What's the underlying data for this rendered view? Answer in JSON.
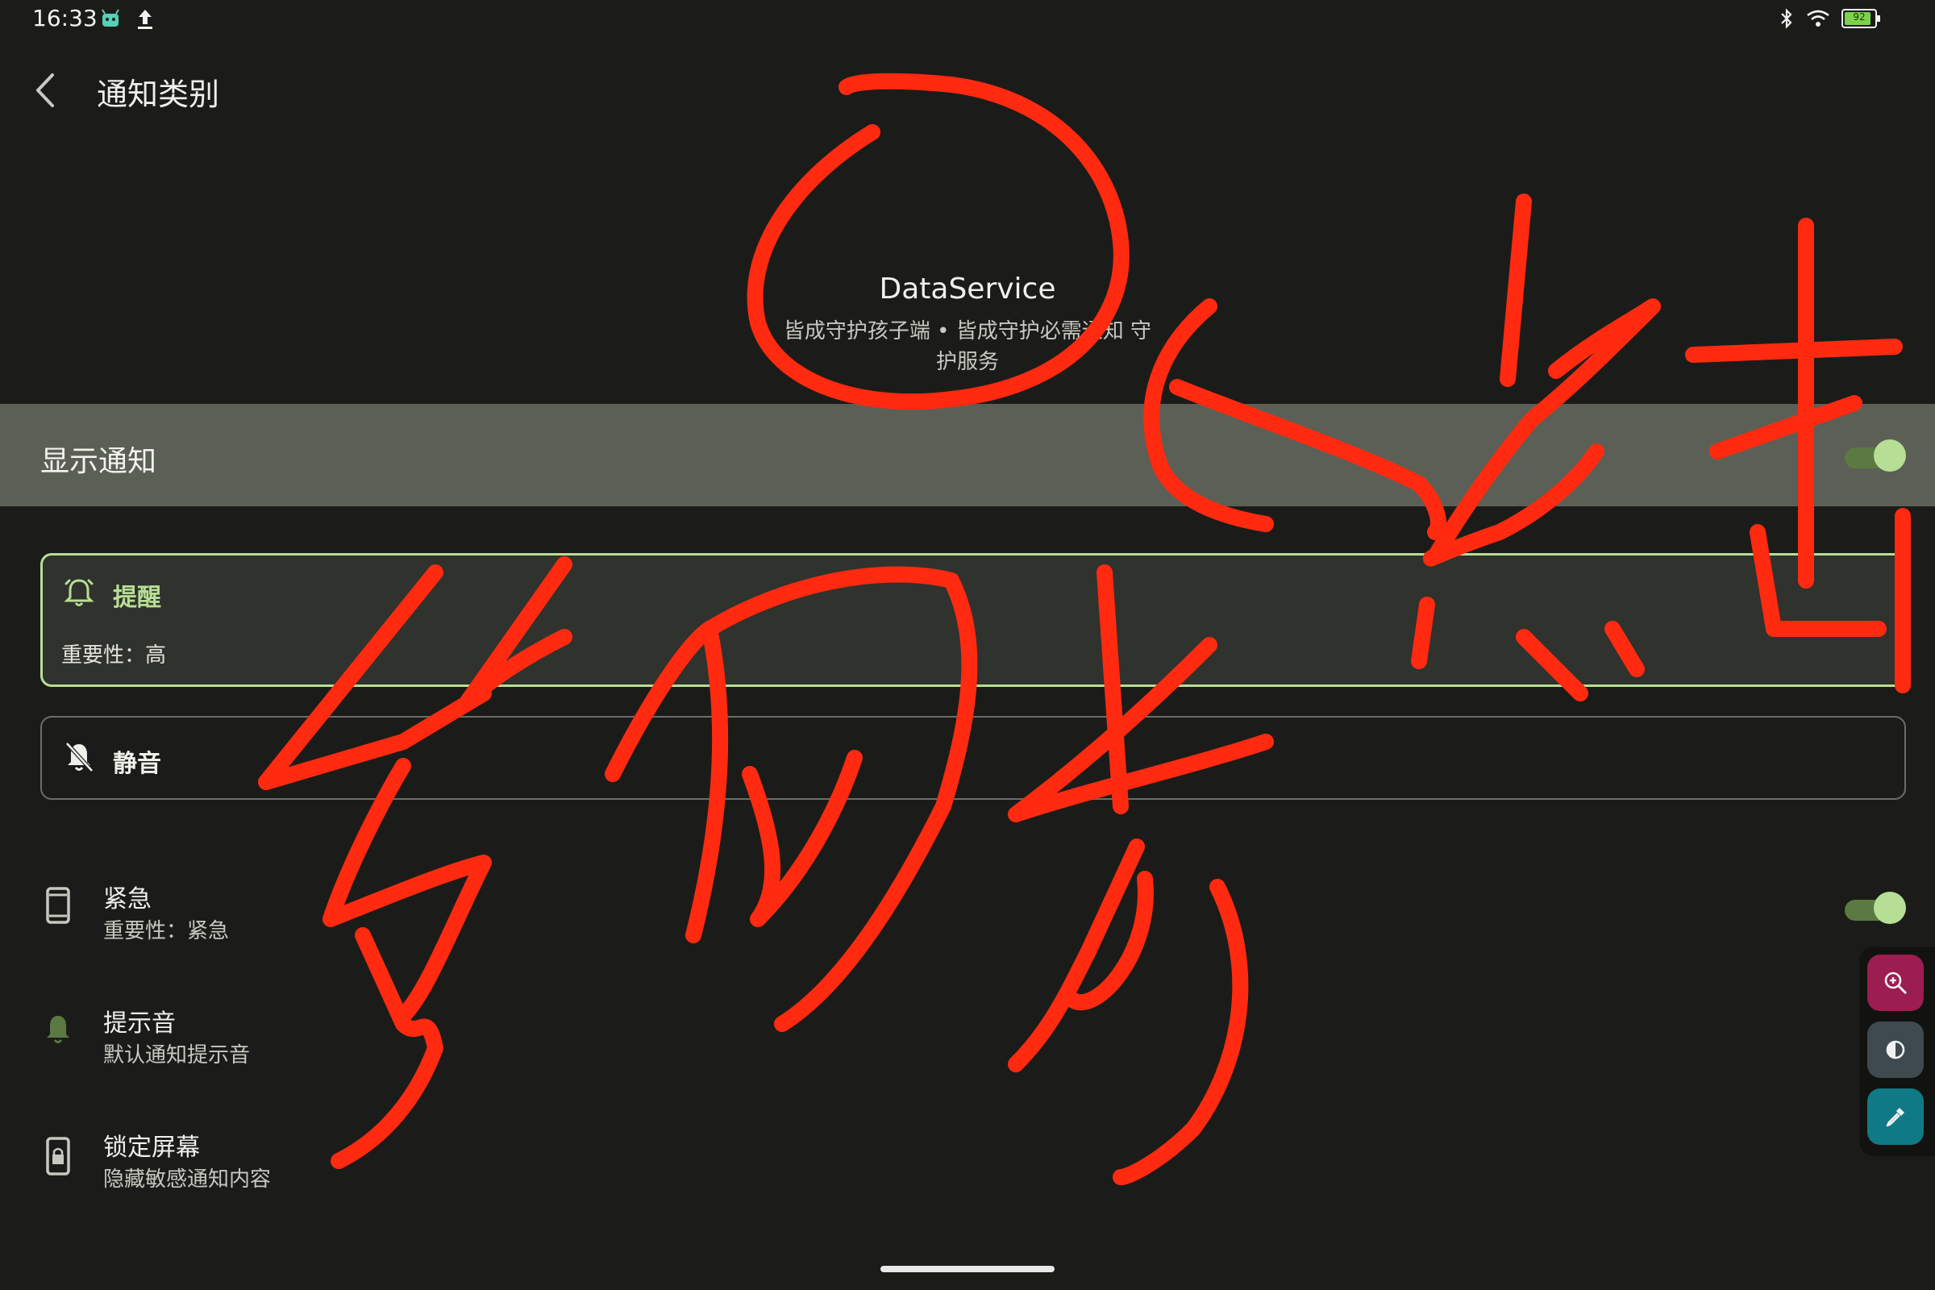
{
  "status_bar": {
    "time": "16:33",
    "battery_level": "92"
  },
  "header": {
    "title": "通知类别"
  },
  "app_info": {
    "name": "DataService",
    "description": "皆成守护孩子端 • 皆成守护必需通知 守护服务"
  },
  "show_notifications": {
    "label": "显示通知",
    "enabled": true
  },
  "alert_option": {
    "title": "提醒",
    "subtitle": "重要性：高",
    "selected": true
  },
  "silent_option": {
    "title": "静音",
    "selected": false
  },
  "settings_list": [
    {
      "title": "紧急",
      "subtitle": "重要性：紧急",
      "icon": "phone-icon",
      "toggle": true
    },
    {
      "title": "提示音",
      "subtitle": "默认通知提示音",
      "icon": "bell-icon"
    },
    {
      "title": "锁定屏幕",
      "subtitle": "隐藏敏感通知内容",
      "icon": "lock-screen-icon"
    }
  ],
  "floating_tools": [
    {
      "icon": "zoom-in-icon",
      "color": "#9c1d4f"
    },
    {
      "icon": "contrast-icon",
      "color": "#3e4a50"
    },
    {
      "icon": "eyedropper-icon",
      "color": "#0f7a86"
    }
  ],
  "colors": {
    "accent": "#b7de95",
    "annotation": "#ff2a10",
    "background": "#1b1c19"
  }
}
